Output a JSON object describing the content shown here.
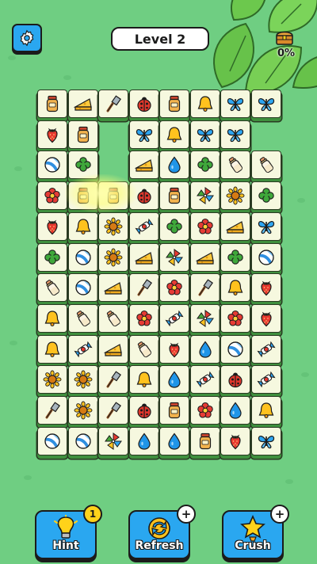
{
  "header": {
    "level_label": "Level 2",
    "progress": "0%"
  },
  "colors": {
    "background": "#6fce82",
    "button_blue": "#2aa7f0",
    "tile_face": "#f6f8df",
    "badge_yellow": "#ffd21a"
  },
  "board": {
    "tiles": [
      [
        "jar",
        "cheese",
        "spatula",
        "ladybug",
        "jar",
        "bell",
        "butterfly",
        "butterfly"
      ],
      [
        "strawberry",
        "jar",
        null,
        "butterfly",
        "bell",
        "butterfly",
        "butterfly"
      ],
      [
        "ball",
        "clover",
        null,
        "cheese",
        "drop",
        "clover",
        "bottle",
        "bottle"
      ],
      [
        "flower",
        "jar",
        "jar",
        "ladybug",
        "jar",
        "pinwheel",
        "sunflower",
        "clover"
      ],
      [
        "strawberry",
        "bell",
        "sunflower",
        "candy",
        "clover",
        "flower",
        "cheese",
        "butterfly"
      ],
      [
        "clover",
        "ball",
        "sunflower",
        "cheese",
        "pinwheel",
        "cheese",
        "clover",
        "ball"
      ],
      [
        "bottle",
        "ball",
        "cheese",
        "spatula",
        "flower",
        "spatula",
        "bell",
        "strawberry"
      ],
      [
        "bell",
        "bottle",
        "bottle",
        "flower",
        "candy",
        "pinwheel",
        "flower",
        "strawberry"
      ],
      [
        "bell",
        "candy",
        "cheese",
        "bottle",
        "strawberry",
        "drop",
        "ball",
        "candy"
      ],
      [
        "sunflower",
        "sunflower",
        "spatula",
        "bell",
        "drop",
        "candy",
        "ladybug",
        "candy"
      ],
      [
        "spatula",
        "sunflower",
        "spatula",
        "ladybug",
        "jar",
        "flower",
        "drop",
        "bell"
      ],
      [
        "ball",
        "ball",
        "pinwheel",
        "drop",
        "drop",
        "jar",
        "strawberry",
        "butterfly"
      ]
    ],
    "highlighted": [
      "jar-row4-col2",
      "jar-row4-col3"
    ]
  },
  "tools": [
    {
      "id": "hint",
      "label": "Hint",
      "icon": "lightbulb-icon",
      "badge": "1",
      "badge_type": "count"
    },
    {
      "id": "refresh",
      "label": "Refresh",
      "icon": "refresh-icon",
      "badge": "+",
      "badge_type": "plus"
    },
    {
      "id": "crush",
      "label": "Crush",
      "icon": "star-hammer-icon",
      "badge": "+",
      "badge_type": "plus"
    }
  ]
}
